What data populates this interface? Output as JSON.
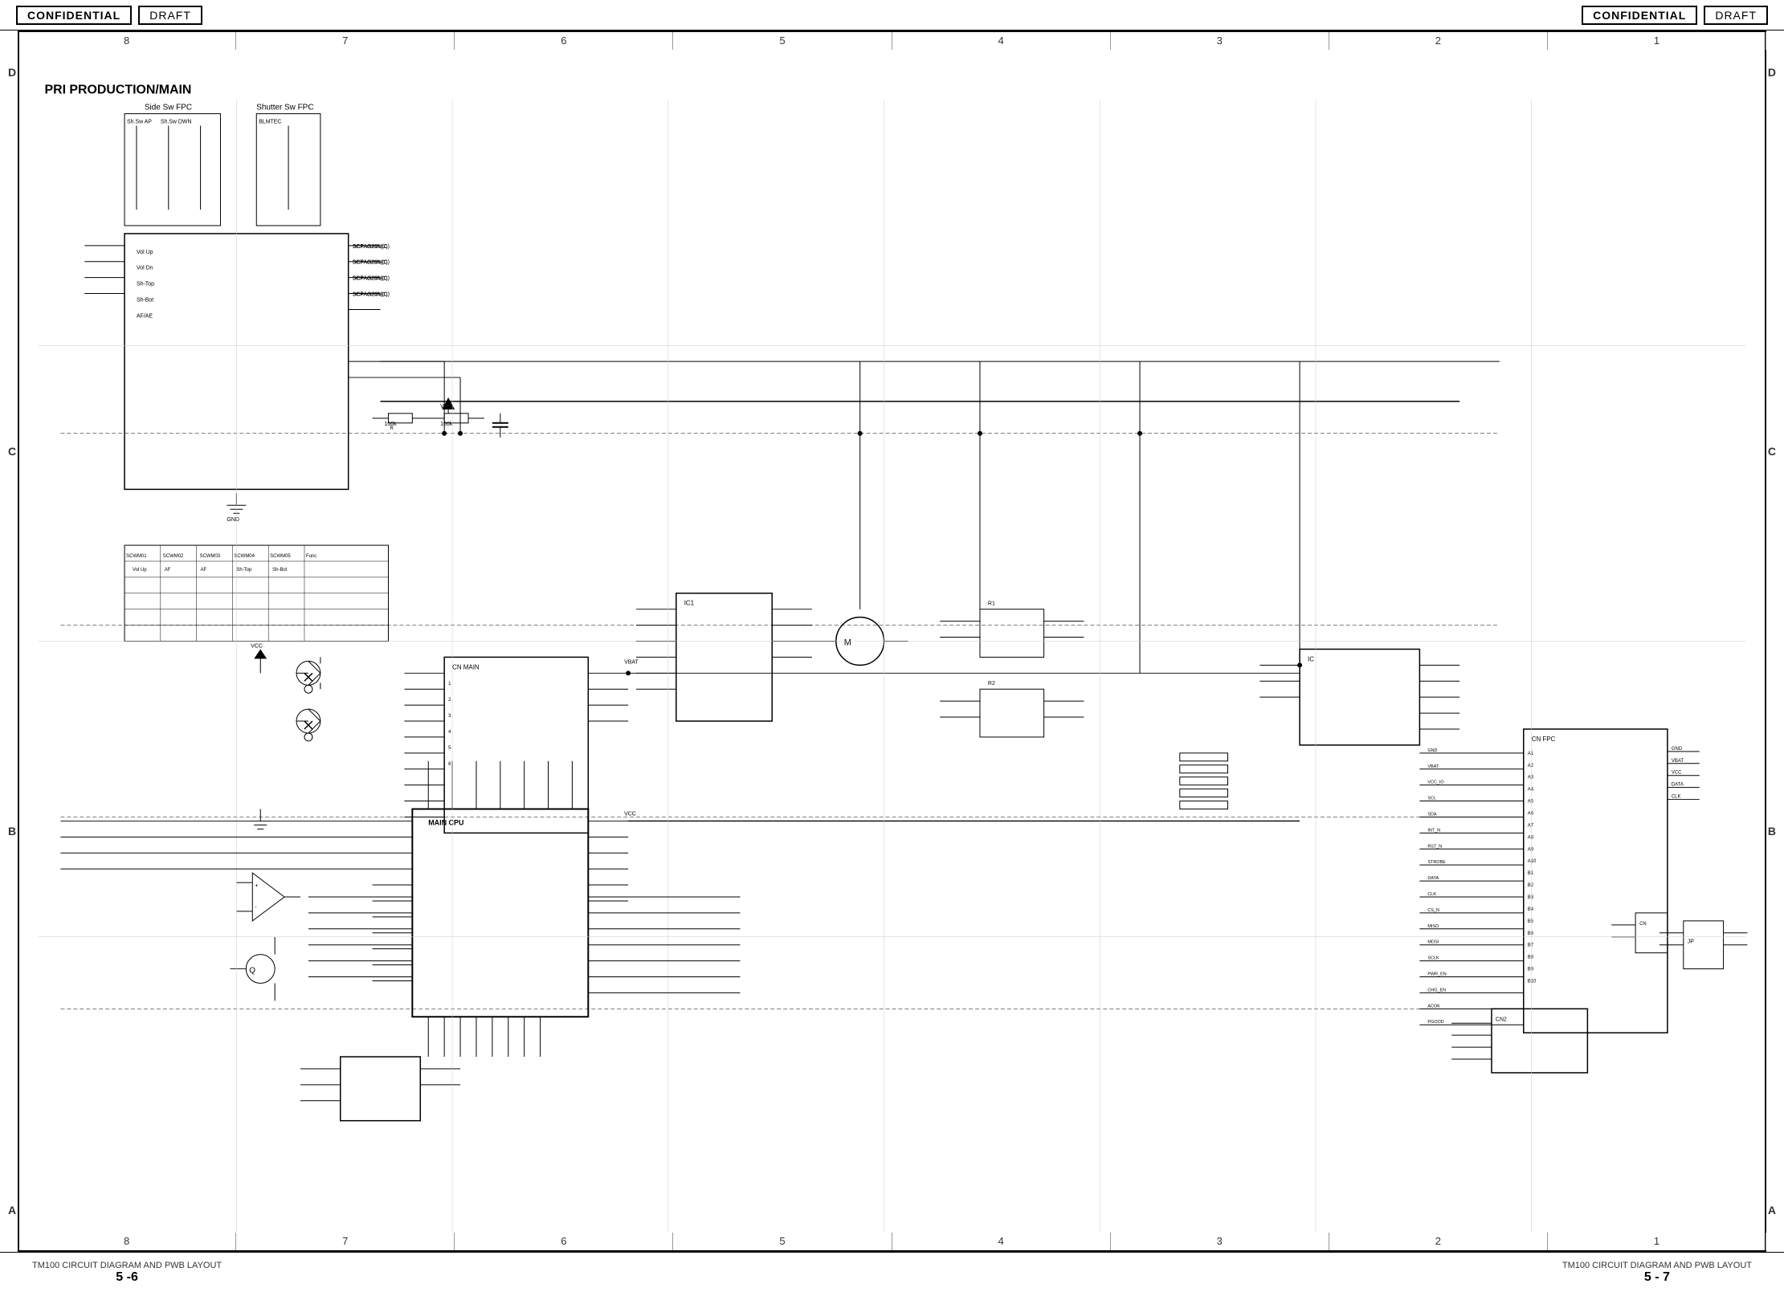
{
  "header": {
    "left_confidential": "CONFIDENTIAL",
    "left_draft": "DRAFT",
    "right_confidential": "CONFIDENTIAL",
    "right_draft": "DRAFT"
  },
  "title": "PRI PRODUCTION/MAIN",
  "grid": {
    "top_numbers": [
      "8",
      "7",
      "6",
      "5",
      "4",
      "3",
      "2",
      "1"
    ],
    "bottom_numbers": [
      "8",
      "7",
      "6",
      "5",
      "4",
      "3",
      "2",
      "1"
    ],
    "left_letters": [
      "D",
      "C",
      "B",
      "A"
    ],
    "right_letters": [
      "D",
      "C",
      "B",
      "A"
    ]
  },
  "footer": {
    "left_label": "TM100 CIRCUIT DIAGRAM AND PWB LAYOUT",
    "left_number": "5 -6",
    "right_label": "TM100 CIRCUIT DIAGRAM AND PWB LAYOUT",
    "right_number": "5 - 7"
  }
}
